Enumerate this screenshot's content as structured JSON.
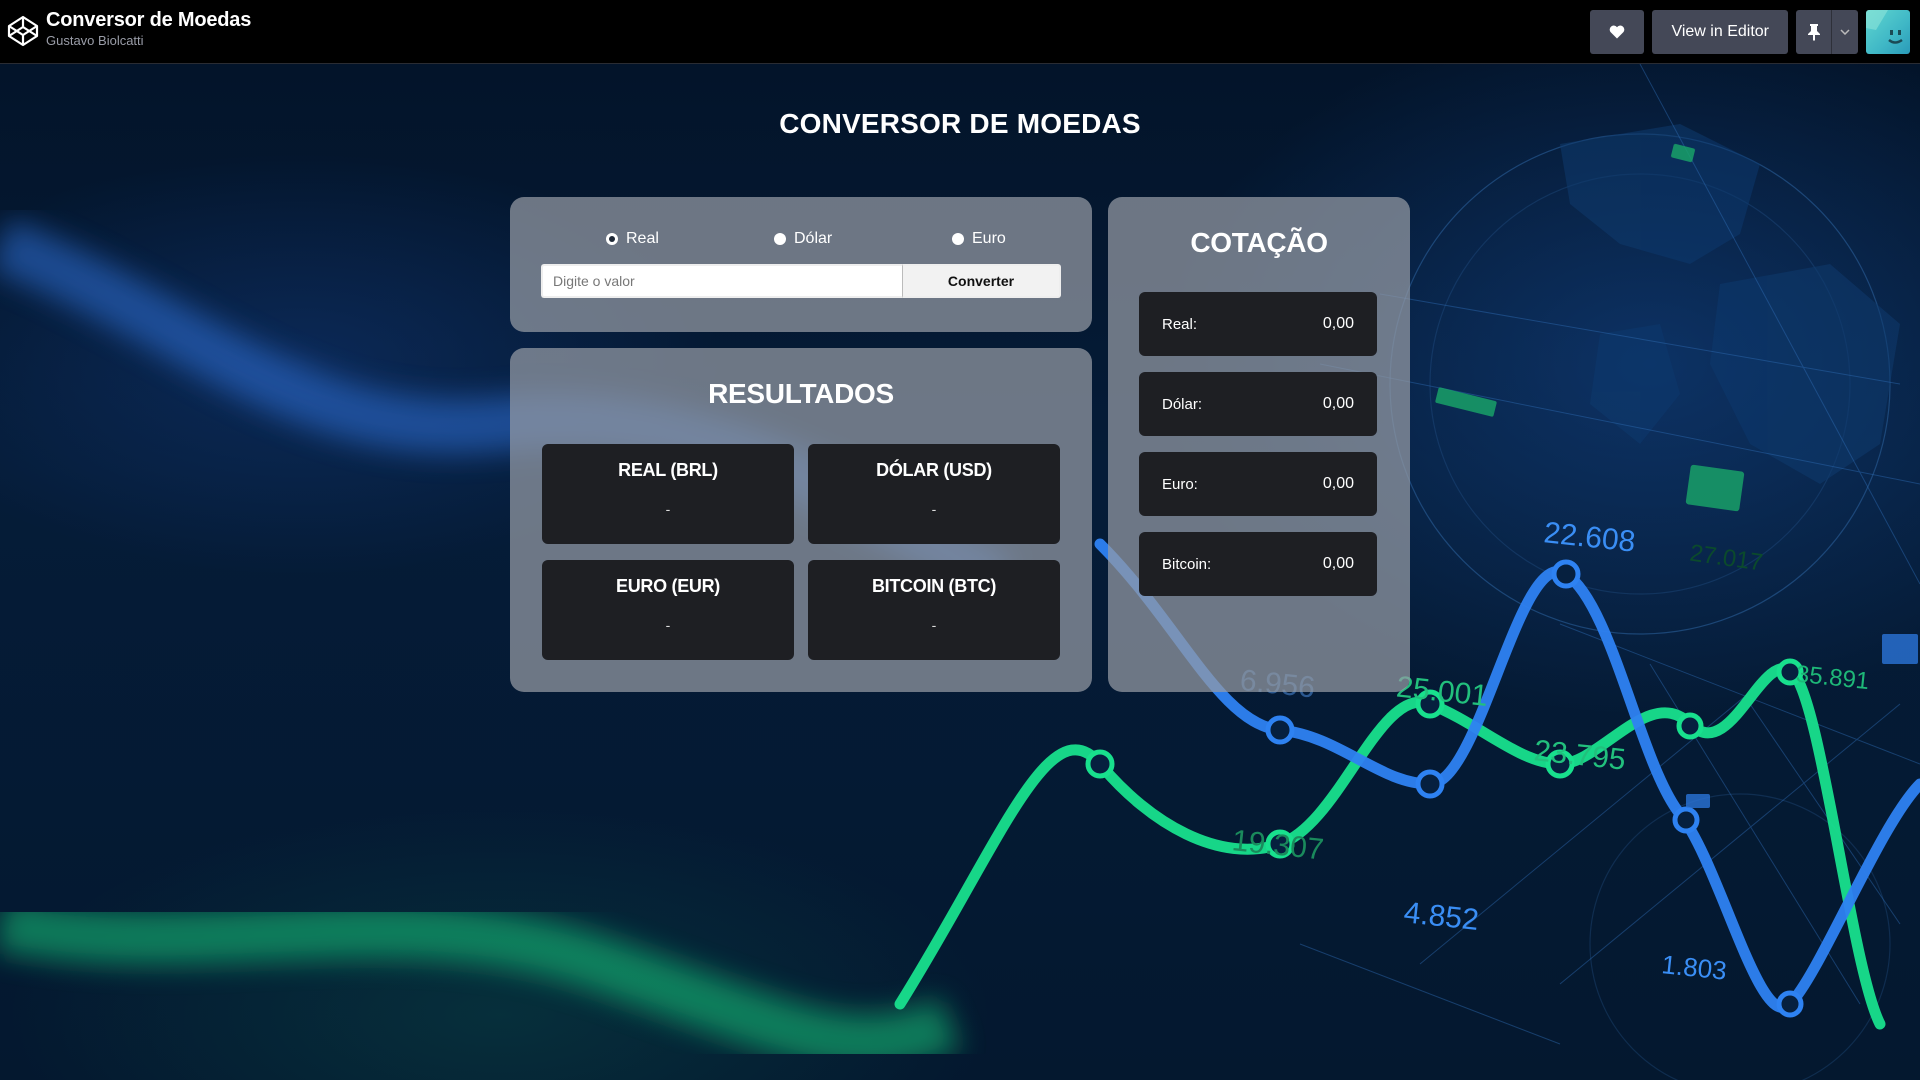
{
  "codepen": {
    "title": "Conversor de Moedas",
    "author": "Gustavo Biolcatti",
    "view_in_editor": "View in Editor",
    "icons": {
      "logo": "codepen-logo-icon",
      "heart": "heart-icon",
      "pin": "pin-icon",
      "caret": "chevron-down-icon"
    }
  },
  "app": {
    "title": "CONVERSOR DE MOEDAS",
    "currency_options": [
      "Real",
      "Dólar",
      "Euro"
    ],
    "selected_currency": "Real",
    "input_placeholder": "Digite o valor",
    "input_value": "",
    "convert_label": "Converter",
    "results": {
      "heading": "RESULTADOS",
      "cards": [
        {
          "label": "REAL (BRL)",
          "value": "-"
        },
        {
          "label": "DÓLAR (USD)",
          "value": "-"
        },
        {
          "label": "EURO (EUR)",
          "value": "-"
        },
        {
          "label": "BITCOIN (BTC)",
          "value": "-"
        }
      ]
    },
    "quotes": {
      "heading": "COTAÇÃO",
      "rows": [
        {
          "label": "Real:",
          "value": "0,00"
        },
        {
          "label": "Dólar:",
          "value": "0,00"
        },
        {
          "label": "Euro:",
          "value": "0,00"
        },
        {
          "label": "Bitcoin:",
          "value": "0,00"
        }
      ]
    }
  },
  "background_labels": [
    "22.608",
    "27.017",
    "6.956",
    "25.001",
    "35.891",
    "23.795",
    "19.307",
    "4.852",
    "1.803"
  ],
  "colors": {
    "panel_bg": "#969ba5",
    "card_bg": "#1e1f23",
    "header_bg": "#000000",
    "button_bg": "#444857",
    "chart_green": "#1fe08a",
    "chart_blue": "#2a7cf0"
  }
}
